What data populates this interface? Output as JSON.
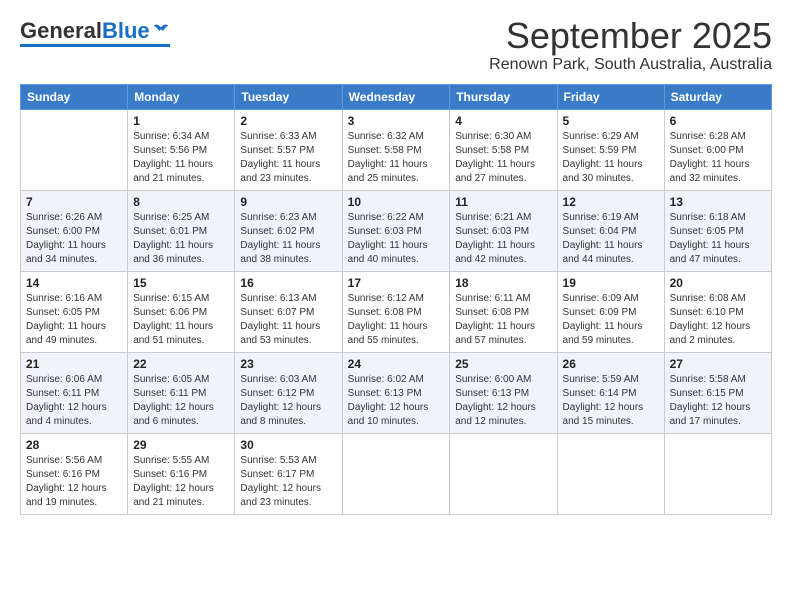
{
  "logo": {
    "general": "General",
    "blue": "Blue"
  },
  "title": "September 2025",
  "location": "Renown Park, South Australia, Australia",
  "days_of_week": [
    "Sunday",
    "Monday",
    "Tuesday",
    "Wednesday",
    "Thursday",
    "Friday",
    "Saturday"
  ],
  "weeks": [
    [
      {
        "day": "",
        "info": ""
      },
      {
        "day": "1",
        "info": "Sunrise: 6:34 AM\nSunset: 5:56 PM\nDaylight: 11 hours\nand 21 minutes."
      },
      {
        "day": "2",
        "info": "Sunrise: 6:33 AM\nSunset: 5:57 PM\nDaylight: 11 hours\nand 23 minutes."
      },
      {
        "day": "3",
        "info": "Sunrise: 6:32 AM\nSunset: 5:58 PM\nDaylight: 11 hours\nand 25 minutes."
      },
      {
        "day": "4",
        "info": "Sunrise: 6:30 AM\nSunset: 5:58 PM\nDaylight: 11 hours\nand 27 minutes."
      },
      {
        "day": "5",
        "info": "Sunrise: 6:29 AM\nSunset: 5:59 PM\nDaylight: 11 hours\nand 30 minutes."
      },
      {
        "day": "6",
        "info": "Sunrise: 6:28 AM\nSunset: 6:00 PM\nDaylight: 11 hours\nand 32 minutes."
      }
    ],
    [
      {
        "day": "7",
        "info": "Sunrise: 6:26 AM\nSunset: 6:00 PM\nDaylight: 11 hours\nand 34 minutes."
      },
      {
        "day": "8",
        "info": "Sunrise: 6:25 AM\nSunset: 6:01 PM\nDaylight: 11 hours\nand 36 minutes."
      },
      {
        "day": "9",
        "info": "Sunrise: 6:23 AM\nSunset: 6:02 PM\nDaylight: 11 hours\nand 38 minutes."
      },
      {
        "day": "10",
        "info": "Sunrise: 6:22 AM\nSunset: 6:03 PM\nDaylight: 11 hours\nand 40 minutes."
      },
      {
        "day": "11",
        "info": "Sunrise: 6:21 AM\nSunset: 6:03 PM\nDaylight: 11 hours\nand 42 minutes."
      },
      {
        "day": "12",
        "info": "Sunrise: 6:19 AM\nSunset: 6:04 PM\nDaylight: 11 hours\nand 44 minutes."
      },
      {
        "day": "13",
        "info": "Sunrise: 6:18 AM\nSunset: 6:05 PM\nDaylight: 11 hours\nand 47 minutes."
      }
    ],
    [
      {
        "day": "14",
        "info": "Sunrise: 6:16 AM\nSunset: 6:05 PM\nDaylight: 11 hours\nand 49 minutes."
      },
      {
        "day": "15",
        "info": "Sunrise: 6:15 AM\nSunset: 6:06 PM\nDaylight: 11 hours\nand 51 minutes."
      },
      {
        "day": "16",
        "info": "Sunrise: 6:13 AM\nSunset: 6:07 PM\nDaylight: 11 hours\nand 53 minutes."
      },
      {
        "day": "17",
        "info": "Sunrise: 6:12 AM\nSunset: 6:08 PM\nDaylight: 11 hours\nand 55 minutes."
      },
      {
        "day": "18",
        "info": "Sunrise: 6:11 AM\nSunset: 6:08 PM\nDaylight: 11 hours\nand 57 minutes."
      },
      {
        "day": "19",
        "info": "Sunrise: 6:09 AM\nSunset: 6:09 PM\nDaylight: 11 hours\nand 59 minutes."
      },
      {
        "day": "20",
        "info": "Sunrise: 6:08 AM\nSunset: 6:10 PM\nDaylight: 12 hours\nand 2 minutes."
      }
    ],
    [
      {
        "day": "21",
        "info": "Sunrise: 6:06 AM\nSunset: 6:11 PM\nDaylight: 12 hours\nand 4 minutes."
      },
      {
        "day": "22",
        "info": "Sunrise: 6:05 AM\nSunset: 6:11 PM\nDaylight: 12 hours\nand 6 minutes."
      },
      {
        "day": "23",
        "info": "Sunrise: 6:03 AM\nSunset: 6:12 PM\nDaylight: 12 hours\nand 8 minutes."
      },
      {
        "day": "24",
        "info": "Sunrise: 6:02 AM\nSunset: 6:13 PM\nDaylight: 12 hours\nand 10 minutes."
      },
      {
        "day": "25",
        "info": "Sunrise: 6:00 AM\nSunset: 6:13 PM\nDaylight: 12 hours\nand 12 minutes."
      },
      {
        "day": "26",
        "info": "Sunrise: 5:59 AM\nSunset: 6:14 PM\nDaylight: 12 hours\nand 15 minutes."
      },
      {
        "day": "27",
        "info": "Sunrise: 5:58 AM\nSunset: 6:15 PM\nDaylight: 12 hours\nand 17 minutes."
      }
    ],
    [
      {
        "day": "28",
        "info": "Sunrise: 5:56 AM\nSunset: 6:16 PM\nDaylight: 12 hours\nand 19 minutes."
      },
      {
        "day": "29",
        "info": "Sunrise: 5:55 AM\nSunset: 6:16 PM\nDaylight: 12 hours\nand 21 minutes."
      },
      {
        "day": "30",
        "info": "Sunrise: 5:53 AM\nSunset: 6:17 PM\nDaylight: 12 hours\nand 23 minutes."
      },
      {
        "day": "",
        "info": ""
      },
      {
        "day": "",
        "info": ""
      },
      {
        "day": "",
        "info": ""
      },
      {
        "day": "",
        "info": ""
      }
    ]
  ]
}
